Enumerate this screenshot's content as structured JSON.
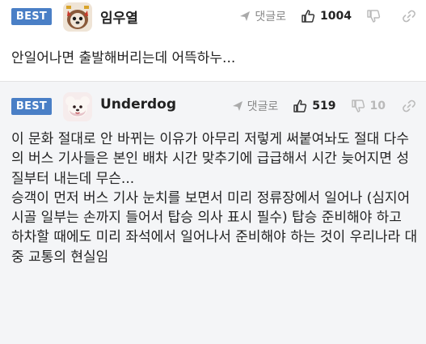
{
  "comments": [
    {
      "badge": "BEST",
      "nickname": "임우열",
      "reply_label": "댓글로",
      "likes": "1004",
      "dislikes": "",
      "text": "안일어나면 출발해버리는데 어뜩하누..."
    },
    {
      "badge": "BEST",
      "nickname": "Underdog",
      "reply_label": "댓글로",
      "likes": "519",
      "dislikes": "10",
      "text": "이 문화 절대로 안 바뀌는 이유가 아무리 저렇게 써붙여놔도 절대 다수의 버스 기사들은 본인 배차 시간 맞추기에 급급해서 시간 늦어지면 성질부터 내는데 무슨...\n승객이 먼저 버스 기사 눈치를 보면서 미리 정류장에서 일어나 (심지어 시골 일부는 손까지 들어서 탑승 의사 표시 필수) 탑승 준비해야 하고 하차할 때에도 미리 좌석에서 일어나서 준비해야 하는 것이 우리나라 대중 교통의 현실임"
    }
  ],
  "icons": {
    "reply": "reply-arrow-icon",
    "like": "thumbs-up-icon",
    "dislike": "thumbs-down-icon",
    "link": "link-icon"
  },
  "colors": {
    "best_badge": "#4a7fc6",
    "best_background": "#f4f5f7"
  }
}
